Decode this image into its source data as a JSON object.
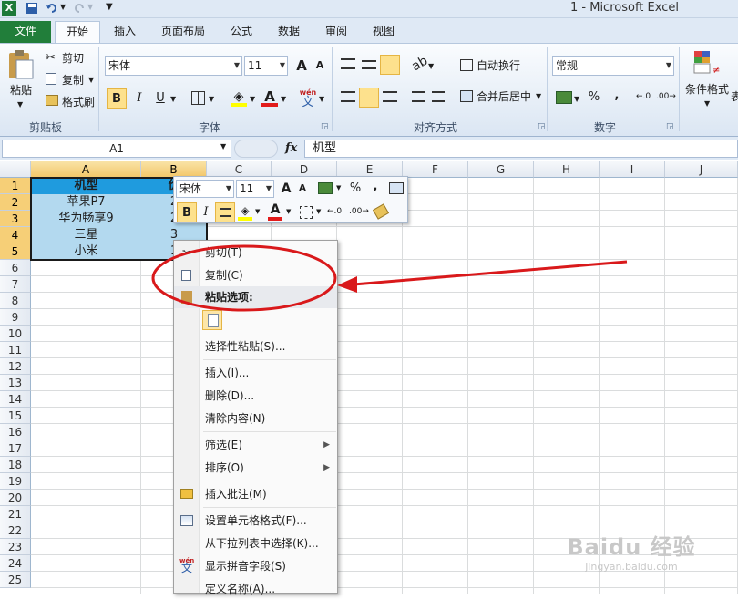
{
  "app": {
    "title": "1 - Microsoft Excel",
    "excel_logo": "X"
  },
  "quick_access": {
    "save_icon": "save-icon",
    "undo_icon": "undo-icon",
    "redo_icon": "redo-icon",
    "customize_icon": "customize-icon"
  },
  "tabs": [
    {
      "label": "文件"
    },
    {
      "label": "开始"
    },
    {
      "label": "插入"
    },
    {
      "label": "页面布局"
    },
    {
      "label": "公式"
    },
    {
      "label": "数据"
    },
    {
      "label": "审阅"
    },
    {
      "label": "视图"
    }
  ],
  "ribbon": {
    "clipboard": {
      "paste_label": "粘贴",
      "cut_label": "剪切",
      "copy_label": "复制",
      "format_painter_label": "格式刷",
      "group_label": "剪贴板"
    },
    "font": {
      "font_name": "宋体",
      "font_size": "11",
      "bold": "B",
      "italic": "I",
      "underline": "U",
      "grow": "A",
      "shrink": "A",
      "font_color_letter": "A",
      "wen": "wén",
      "wen_char": "文",
      "group_label": "字体"
    },
    "alignment": {
      "wrap_label": "自动换行",
      "merge_label": "合并后居中",
      "group_label": "对齐方式"
    },
    "number": {
      "format": "常规",
      "percent": "%",
      "comma": ",",
      "group_label": "数字"
    },
    "styles": {
      "conditional_label": "条件格式",
      "extra_label": "表"
    }
  },
  "formula_bar": {
    "name_box": "A1",
    "fx": "fx",
    "value": "机型"
  },
  "sheet": {
    "columns": [
      "A",
      "B",
      "C",
      "D",
      "E",
      "F",
      "G",
      "H",
      "I",
      "J"
    ],
    "rows": [
      "1",
      "2",
      "3",
      "4",
      "5",
      "6",
      "7",
      "8",
      "9",
      "10",
      "11",
      "12",
      "13",
      "14",
      "15",
      "16",
      "17",
      "18",
      "19",
      "20",
      "21",
      "22",
      "23",
      "24",
      "25"
    ],
    "cells": {
      "a1": "机型",
      "b1": "价",
      "a2": "苹果P7",
      "b2": "2",
      "a3": "华为畅享9",
      "b3": "2",
      "a4": "三星",
      "b4": "3",
      "a5": "小米",
      "b5": "1"
    }
  },
  "mini_toolbar": {
    "font_name": "宋体",
    "font_size": "11",
    "grow": "A",
    "shrink": "A",
    "percent": "%",
    "comma": ",",
    "bold": "B",
    "italic": "I",
    "font_color_letter": "A"
  },
  "context_menu": {
    "cut": "剪切(T)",
    "copy": "复制(C)",
    "paste_options": "粘贴选项:",
    "paste_special": "选择性粘贴(S)...",
    "insert": "插入(I)...",
    "delete": "删除(D)...",
    "clear": "清除内容(N)",
    "filter": "筛选(E)",
    "sort": "排序(O)",
    "insert_comment": "插入批注(M)",
    "format_cells": "设置单元格格式(F)...",
    "pick_from_list": "从下拉列表中选择(K)...",
    "phonetic": "显示拼音字段(S)",
    "define_name": "定义名称(A)...",
    "submenu_arrow": "▶"
  },
  "watermark": {
    "brand": "Baidu 经验",
    "url": "jingyan.baidu.com"
  },
  "colors": {
    "accent_red": "#d9191b",
    "header_cell": "#1f9bde",
    "selected_fill": "#b3d9ef",
    "file_tab": "#217e3a"
  }
}
